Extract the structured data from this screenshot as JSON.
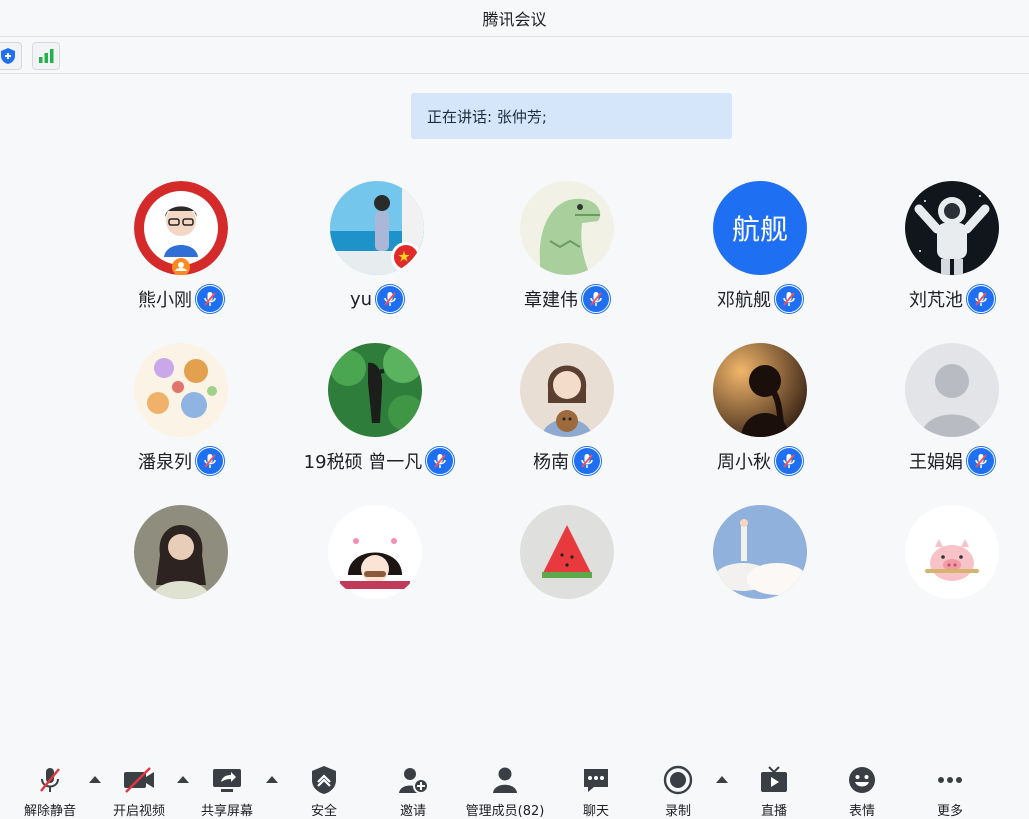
{
  "window": {
    "title": "腾讯会议"
  },
  "banner": {
    "speaking_text": "正在讲话: 张仲芳;"
  },
  "colors": {
    "accent": "#1e6ff1",
    "banner_bg": "#d5e6fb",
    "signal": "#22b14c"
  },
  "participants": [
    {
      "name": "熊小刚",
      "muted": true
    },
    {
      "name": "yu",
      "muted": true
    },
    {
      "name": "章建伟",
      "muted": true
    },
    {
      "name": "邓航舰",
      "muted": true,
      "avatar_text": "航舰"
    },
    {
      "name": "刘芃池",
      "muted": true
    },
    {
      "name": "潘泉列",
      "muted": true
    },
    {
      "name": "19税硕  曾一凡",
      "muted": true
    },
    {
      "name": "杨南",
      "muted": true
    },
    {
      "name": "周小秋",
      "muted": true
    },
    {
      "name": "王娟娟",
      "muted": true
    },
    {
      "name": "",
      "muted": false
    },
    {
      "name": "",
      "muted": false
    },
    {
      "name": "",
      "muted": false
    },
    {
      "name": "",
      "muted": false
    },
    {
      "name": "",
      "muted": false
    }
  ],
  "toolbar": {
    "unmute": "解除静音",
    "start_video": "开启视频",
    "share_screen": "共享屏幕",
    "security": "安全",
    "invite": "邀请",
    "manage_members": "管理成员(82)",
    "chat": "聊天",
    "record": "录制",
    "live": "直播",
    "reactions": "表情",
    "more": "更多"
  }
}
